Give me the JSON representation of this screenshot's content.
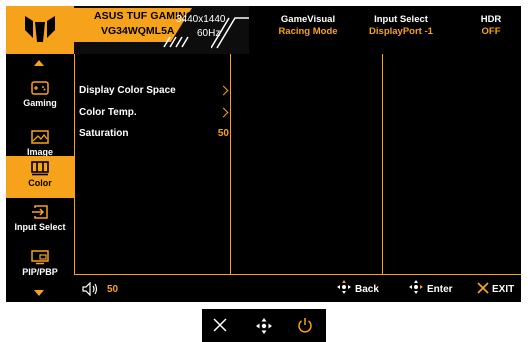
{
  "header": {
    "brand": "ASUS TUF GAMING",
    "model": "VG34WQML5A",
    "resolution": "3440x1440",
    "refresh": "60Hz",
    "items": [
      {
        "label": "GameVisual",
        "value": "Racing Mode"
      },
      {
        "label": "Input Select",
        "value": "DisplayPort -1"
      },
      {
        "label": "HDR",
        "value": "OFF"
      }
    ]
  },
  "sidebar": {
    "items": [
      {
        "label": "Gaming",
        "icon": "gamepad-icon"
      },
      {
        "label": "Image",
        "icon": "picture-icon"
      },
      {
        "label": "Color",
        "icon": "color-bars-icon",
        "active": true
      },
      {
        "label": "Input Select",
        "icon": "input-arrow-icon"
      },
      {
        "label": "PIP/PBP",
        "icon": "pip-icon"
      }
    ]
  },
  "menu": {
    "items": [
      {
        "label": "Display Color Space",
        "type": "submenu"
      },
      {
        "label": "Color Temp.",
        "type": "submenu"
      },
      {
        "label": "Saturation",
        "value": "50"
      }
    ]
  },
  "footer": {
    "volume": "50",
    "back": "Back",
    "enter": "Enter",
    "exit": "EXIT"
  },
  "colors": {
    "accent": "#f7a21b",
    "background": "#000000",
    "text": "#ffffff"
  }
}
